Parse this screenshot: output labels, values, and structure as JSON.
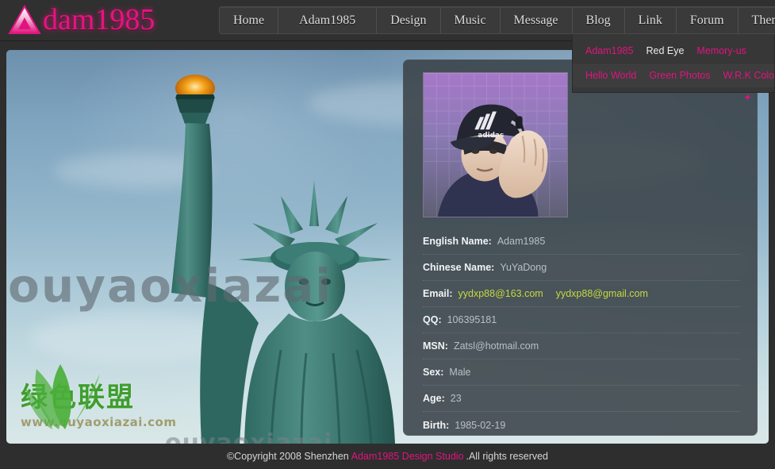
{
  "site": {
    "logo_text": "dam1985",
    "logo_icon": "triangle-a-icon"
  },
  "nav": {
    "items": [
      {
        "label": "Home"
      },
      {
        "label": "Adam1985"
      },
      {
        "label": "Design"
      },
      {
        "label": "Music"
      },
      {
        "label": "Message"
      },
      {
        "label": "Blog"
      },
      {
        "label": "Link"
      },
      {
        "label": "Forum"
      },
      {
        "label": "Themes"
      }
    ],
    "themes_chevron": "ˇ"
  },
  "themes_menu": {
    "row1": [
      {
        "label": "Adam1985",
        "color": "#e0147e",
        "active": true
      },
      {
        "label": "Red Eye",
        "color": "#eaeaea",
        "active": false
      },
      {
        "label": "Memory-us",
        "color": "#e0147e",
        "active": false
      }
    ],
    "row2": [
      {
        "label": "Hello World",
        "color": "#e0147e",
        "active": false
      },
      {
        "label": "Green Photos",
        "color": "#e0147e",
        "active": false
      },
      {
        "label": "W.R.K Color",
        "color": "#e0147e",
        "active": false
      }
    ]
  },
  "stage": {
    "background_alt": "statue-of-liberty-photo",
    "watermark_large": "ouyaoxiazai",
    "watermark_mid": "ouyaoxiazai",
    "watermark_logo_text": "绿色联盟",
    "watermark_logo_url": "www.ouyaoxiazai.com"
  },
  "profile": {
    "avatar_alt": "portrait-adidas-cap",
    "rows": [
      {
        "label": "English Name:",
        "value": "Adam1985"
      },
      {
        "label": "Chinese Name:",
        "value": "YuYaDong"
      },
      {
        "label": "Email:",
        "value": "",
        "links": [
          "yydxp88@163.com",
          "yydxp88@gmail.com"
        ]
      },
      {
        "label": "QQ:",
        "value": "106395181"
      },
      {
        "label": "MSN:",
        "value": "Zatsl@hotmail.com"
      },
      {
        "label": "Sex:",
        "value": "Male"
      },
      {
        "label": "Age:",
        "value": "23"
      },
      {
        "label": "Birth:",
        "value": "1985-02-19"
      }
    ]
  },
  "footer": {
    "prefix": "©Copyright 2008 Shenzhen",
    "studio": "Adam1985 Design Studio",
    "suffix": ".All rights reserved"
  },
  "colors": {
    "accent_pink": "#e0147e",
    "link_yellow": "#c6d83f",
    "header_bg": "#303030",
    "panel_bg": "rgba(58,66,72,.88)"
  }
}
